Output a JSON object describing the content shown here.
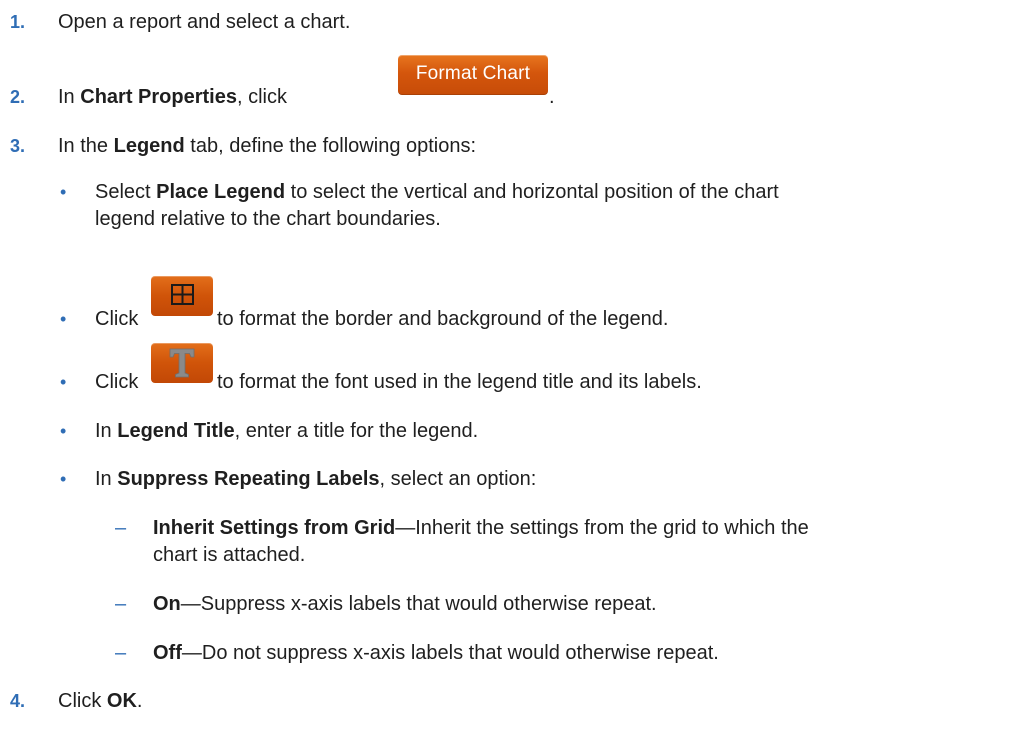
{
  "steps": [
    {
      "num": "1.",
      "text": "Open a report and select a chart."
    },
    {
      "num": "2.",
      "prefix": "In ",
      "bold": "Chart Properties",
      "mid": ", click ",
      "button_label": "Format Chart",
      "suffix": "."
    },
    {
      "num": "3.",
      "prefix": "In the ",
      "bold": "Legend",
      "suffix": " tab, define the following options:"
    },
    {
      "num": "4.",
      "prefix": "Click ",
      "bold": "OK",
      "suffix": "."
    }
  ],
  "legend_options": {
    "place": {
      "prefix": "Select ",
      "bold": "Place Legend",
      "line1_rest": " to select the vertical and horizontal position of the chart",
      "line2": "legend relative to the chart boundaries."
    },
    "border": {
      "prefix": "Click",
      "suffix": "to format the border and background of the legend.",
      "icon": "border-grid-icon"
    },
    "font": {
      "prefix": "Click",
      "suffix": "to format the font used in the legend title and its labels.",
      "icon": "font-t-icon"
    },
    "title": {
      "prefix": "In ",
      "bold": "Legend Title",
      "suffix": ", enter a title for the legend."
    },
    "suppress": {
      "prefix": "In ",
      "bold": "Suppress Repeating Labels",
      "suffix": ", select an option:"
    }
  },
  "suppress_options": [
    {
      "bold": "Inherit Settings from Grid",
      "line1_rest": "—Inherit the settings from the grid to which the",
      "line2": "chart is attached."
    },
    {
      "bold": "On",
      "line1_rest": "—Suppress x-axis labels that would otherwise repeat."
    },
    {
      "bold": "Off",
      "line1_rest": "—Do not suppress x-axis labels that would otherwise repeat."
    }
  ],
  "markers": {
    "bullet": "•",
    "dash": "–"
  },
  "colors": {
    "accent_number": "#2f6db5",
    "button_orange": "#d4560c",
    "text": "#1f1f1f"
  }
}
